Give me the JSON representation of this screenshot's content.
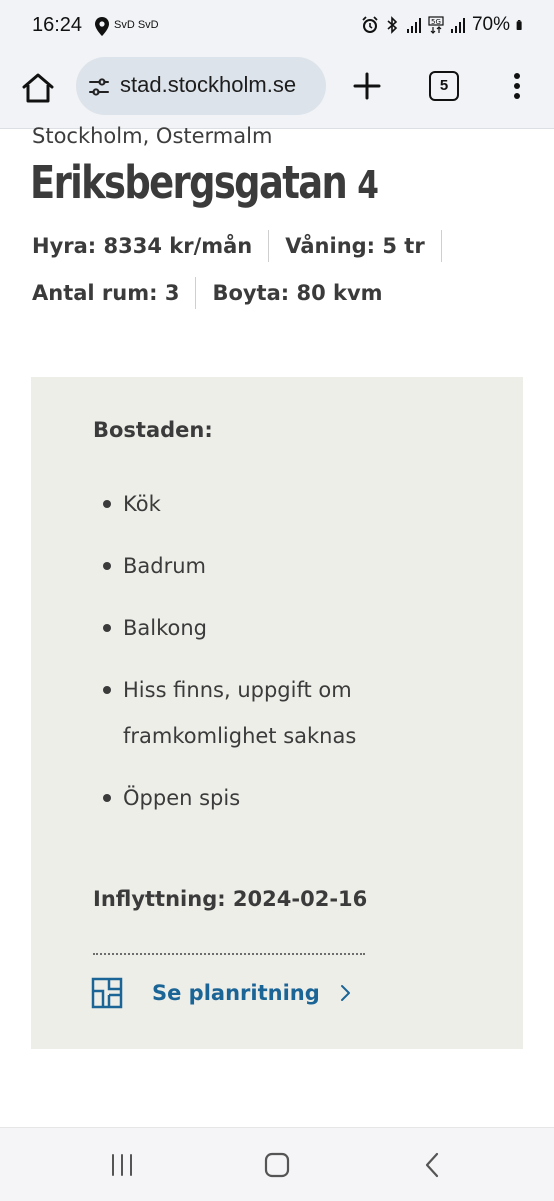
{
  "status_bar": {
    "time": "16:24",
    "carrier": "SvD SvD",
    "battery": "70%",
    "icons": [
      "location-icon",
      "alarm-icon",
      "bluetooth-icon",
      "signal-icon",
      "5g-icon",
      "signal-icon",
      "battery-icon"
    ]
  },
  "browser": {
    "url": "stad.stockholm.se",
    "tab_count": "5",
    "icons": [
      "home-icon",
      "tune-icon",
      "plus-icon",
      "tabs-icon",
      "more-vert-icon"
    ]
  },
  "listing": {
    "area": "Stockholm, Ostermalm",
    "street_name": "Eriksbergsgatan",
    "street_number": "4",
    "rent": "Hyra: 8334 kr/mån",
    "floor": "Våning: 5 tr",
    "rooms": "Antal rum: 3",
    "size": "Boyta: 80 kvm"
  },
  "details": {
    "title": "Bostaden:",
    "features": [
      "Kök",
      "Badrum",
      "Balkong",
      "Hiss finns, uppgift om framkomlighet saknas",
      "Öppen spis"
    ],
    "move_in": "Inflyttning: 2024-02-16",
    "plan_link": "Se planritning"
  },
  "colors": {
    "link": "#1a6496",
    "box_background": "#eeeee9",
    "text": "#3b3b3b"
  },
  "nav": {
    "icons": [
      "recent-apps-icon",
      "home-icon",
      "back-icon"
    ]
  }
}
